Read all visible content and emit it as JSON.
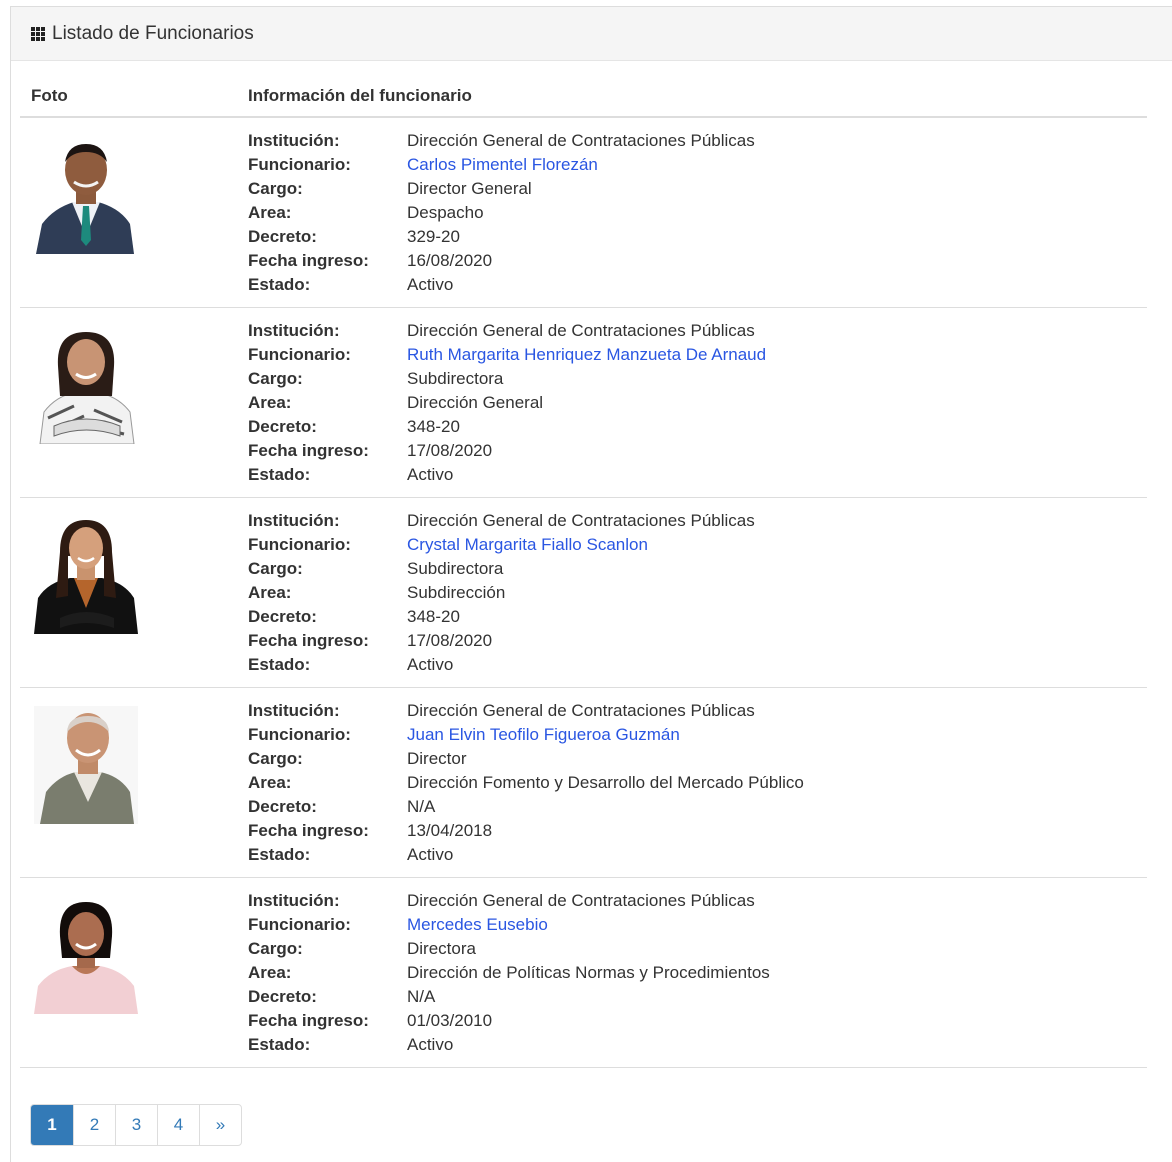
{
  "panel": {
    "title": "Listado de Funcionarios"
  },
  "table": {
    "headers": {
      "photo": "Foto",
      "info": "Información del funcionario"
    },
    "labels": {
      "institucion": "Institución:",
      "funcionario": "Funcionario:",
      "cargo": "Cargo:",
      "area": "Area:",
      "decreto": "Decreto:",
      "fecha": "Fecha ingreso:",
      "estado": "Estado:"
    },
    "rows": [
      {
        "institucion": "Dirección General de Contrataciones Públicas",
        "funcionario": "Carlos Pimentel Florezán",
        "cargo": "Director General",
        "area": "Despacho",
        "decreto": "329-20",
        "fecha": "16/08/2020",
        "estado": "Activo"
      },
      {
        "institucion": "Dirección General de Contrataciones Públicas",
        "funcionario": "Ruth Margarita Henriquez Manzueta De Arnaud",
        "cargo": "Subdirectora",
        "area": "Dirección General",
        "decreto": "348-20",
        "fecha": "17/08/2020",
        "estado": "Activo"
      },
      {
        "institucion": "Dirección General de Contrataciones Públicas",
        "funcionario": "Crystal Margarita Fiallo Scanlon",
        "cargo": "Subdirectora",
        "area": "Subdirección",
        "decreto": "348-20",
        "fecha": "17/08/2020",
        "estado": "Activo"
      },
      {
        "institucion": "Dirección General de Contrataciones Públicas",
        "funcionario": "Juan Elvin Teofilo Figueroa Guzmán",
        "cargo": "Director",
        "area": "Dirección Fomento y Desarrollo del Mercado Público",
        "decreto": "N/A",
        "fecha": "13/04/2018",
        "estado": "Activo"
      },
      {
        "institucion": "Dirección General de Contrataciones Públicas",
        "funcionario": "Mercedes Eusebio",
        "cargo": "Directora",
        "area": "Dirección de Políticas Normas y Procedimientos",
        "decreto": "N/A",
        "fecha": "01/03/2010",
        "estado": "Activo"
      }
    ]
  },
  "pagination": {
    "pages": [
      "1",
      "2",
      "3",
      "4"
    ],
    "next": "»",
    "active": "1"
  },
  "colors": {
    "accent": "#337ab7",
    "link": "#2a56e2"
  }
}
